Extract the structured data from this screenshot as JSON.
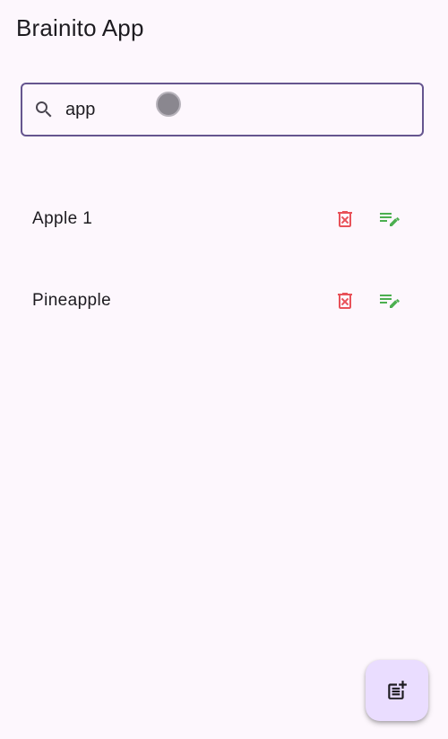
{
  "app": {
    "title": "Brainito App"
  },
  "search": {
    "value": "app",
    "icon": "search-icon",
    "border_color": "#65558f"
  },
  "items": [
    {
      "label": "Apple 1",
      "delete_icon": "delete-forever-icon",
      "edit_icon": "edit-note-icon"
    },
    {
      "label": "Pineapple",
      "delete_icon": "delete-forever-icon",
      "edit_icon": "edit-note-icon"
    }
  ],
  "fab": {
    "icon": "post-add-icon",
    "background": "#eaddff"
  },
  "colors": {
    "background": "#fdf7fd",
    "delete": "#e8525a",
    "edit": "#4caf50",
    "icon_dark": "#1d1b20"
  }
}
